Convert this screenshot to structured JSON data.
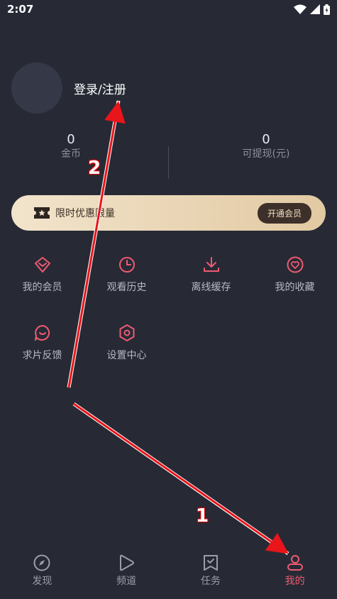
{
  "status_bar": {
    "time": "2:07"
  },
  "profile": {
    "login_label": "登录/注册"
  },
  "stats": {
    "coins_value": "0",
    "coins_label": "金币",
    "cash_value": "0",
    "cash_label": "可提现(元)"
  },
  "vip": {
    "text": "限时优惠限量",
    "button": "开通会员"
  },
  "grid": [
    {
      "label": "我的会员",
      "icon": "diamond-icon"
    },
    {
      "label": "观看历史",
      "icon": "clock-icon"
    },
    {
      "label": "离线缓存",
      "icon": "download-icon"
    },
    {
      "label": "我的收藏",
      "icon": "heart-icon"
    },
    {
      "label": "求片反馈",
      "icon": "chat-icon"
    },
    {
      "label": "设置中心",
      "icon": "hexagon-gear-icon"
    }
  ],
  "nav": [
    {
      "label": "发现",
      "icon": "compass-icon"
    },
    {
      "label": "频道",
      "icon": "play-icon"
    },
    {
      "label": "任务",
      "icon": "task-icon"
    },
    {
      "label": "我的",
      "icon": "user-icon",
      "active": true
    }
  ],
  "annotations": {
    "arrow1": "1",
    "arrow2": "2"
  },
  "colors": {
    "accent": "#ef5a72",
    "background": "#272a35",
    "vip_gold": "#e2c9a2"
  }
}
